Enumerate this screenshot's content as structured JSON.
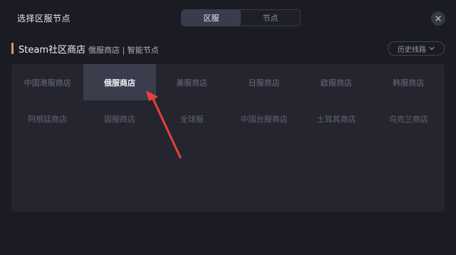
{
  "dialog": {
    "title": "选择区服节点",
    "tabs": [
      {
        "label": "区服",
        "active": true
      },
      {
        "label": "节点",
        "active": false
      }
    ]
  },
  "section": {
    "title": "Steam社区商店",
    "subtitle": "俄服商店 | 智能节点",
    "history_label": "历史线路"
  },
  "regions": [
    {
      "label": "中国港服商店",
      "selected": false
    },
    {
      "label": "俄服商店",
      "selected": true
    },
    {
      "label": "美服商店",
      "selected": false
    },
    {
      "label": "日服商店",
      "selected": false
    },
    {
      "label": "欧服商店",
      "selected": false
    },
    {
      "label": "韩服商店",
      "selected": false
    },
    {
      "label": "阿根廷商店",
      "selected": false
    },
    {
      "label": "国服商店",
      "selected": false
    },
    {
      "label": "全球服",
      "selected": false
    },
    {
      "label": "中国台服商店",
      "selected": false
    },
    {
      "label": "土耳其商店",
      "selected": false
    },
    {
      "label": "乌克兰商店",
      "selected": false
    }
  ],
  "colors": {
    "accent": "#c9a24a",
    "annotation_arrow": "#e8403a"
  },
  "icons": {
    "close": "close-icon",
    "history_dropdown": "chevron-down-icon"
  }
}
